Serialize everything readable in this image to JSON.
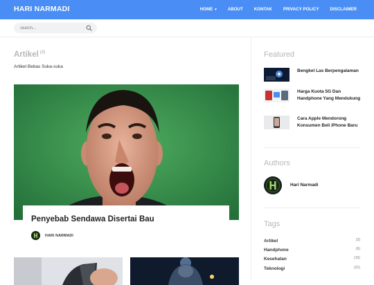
{
  "header": {
    "brand": "HARI NARMADI",
    "nav": [
      {
        "label": "HOME",
        "has_dropdown": true
      },
      {
        "label": "ABOUT"
      },
      {
        "label": "KONTAK"
      },
      {
        "label": "PRIVACY POLICY"
      },
      {
        "label": "DISCLAIMER"
      }
    ],
    "dropdown_caret": "▾"
  },
  "search": {
    "placeholder": "search..."
  },
  "archive": {
    "title": "Artikel",
    "count": "(3)",
    "description": "Artikel Bebas Suka-suka"
  },
  "hero_post": {
    "title": "Penyebab Sendawa Disertai Bau",
    "author": "HARI NARMADI"
  },
  "sidebar": {
    "featured_heading": "Featured",
    "featured": [
      {
        "title": "Bengkel Las Berpengalaman",
        "thumb": "welding-thumb"
      },
      {
        "title": "Harga Kuota 5G Dan Handphone Yang Mendukung",
        "thumb": "5g-thumb"
      },
      {
        "title": "Cara Apple Mendorong Konsumen Beli iPhone Baru",
        "thumb": "iphone-thumb"
      }
    ],
    "authors_heading": "Authors",
    "author_name": "Hari Narmadi",
    "tags_heading": "Tags",
    "tags": [
      {
        "name": "Artikel",
        "count": "(3)"
      },
      {
        "name": "Handphone",
        "count": "(6)"
      },
      {
        "name": "Kesehatan",
        "count": "(16)"
      },
      {
        "name": "Teknologi",
        "count": "(21)"
      }
    ]
  },
  "colors": {
    "accent": "#4a8ef5",
    "muted_heading": "#b7b7b7"
  }
}
